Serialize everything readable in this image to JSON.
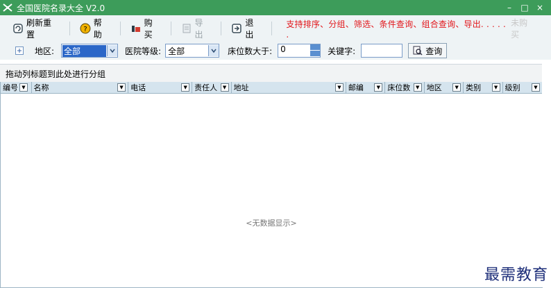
{
  "window": {
    "title": "全国医院名录大全 V2.0",
    "controls": [
      "–",
      "□",
      "×"
    ]
  },
  "toolbar": {
    "refresh": "刷新重置",
    "help": "帮助",
    "buy": "购买",
    "export": "导出",
    "exit": "退出",
    "promo": "支持排序、分组、筛选、条件查询、组合查询、导出. . . . . .",
    "unpaid": "未购买"
  },
  "filters": {
    "region_label": "地区:",
    "region_value": "全部",
    "level_label": "医院等级:",
    "level_value": "全部",
    "beds_label": "床位数大于:",
    "beds_value": "0",
    "keyword_label": "关键字:",
    "keyword_value": "",
    "query_button": "查询"
  },
  "grid": {
    "group_hint": "拖动列标题到此处进行分组",
    "columns": [
      "编号",
      "名称",
      "电话",
      "责任人",
      "地址",
      "邮编",
      "床位数",
      "地区",
      "类别",
      "级别"
    ],
    "empty_text": "<无数据显示>"
  },
  "watermark": "最需教育",
  "colors": {
    "titlebar": "#3d9c5a",
    "promo": "#e2161b",
    "header": "#d5e4ee"
  },
  "icons": [
    "refresh-icon",
    "help-icon",
    "buy-icon",
    "export-icon",
    "exit-icon",
    "search-icon"
  ]
}
